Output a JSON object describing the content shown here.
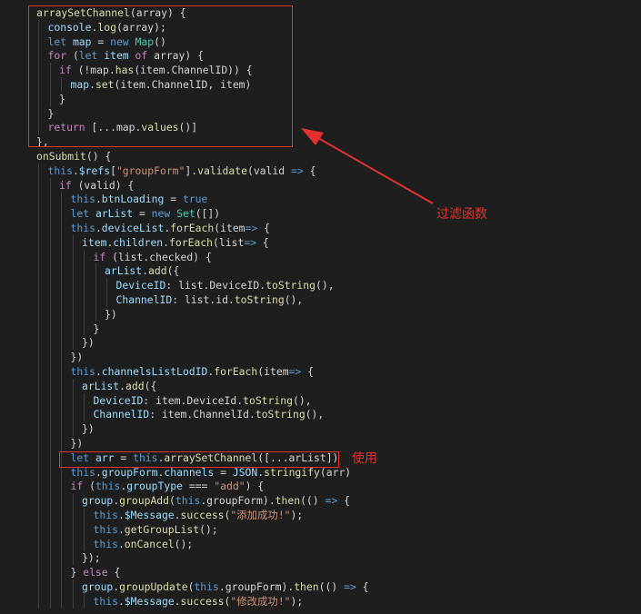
{
  "colors": {
    "background": "#1e1e1e",
    "keyword": "#569cd6",
    "control": "#c586c0",
    "function": "#dcdcaa",
    "variable": "#9cdcfe",
    "class": "#4ec9b0",
    "string": "#ce9178",
    "annotation": "#e0322f"
  },
  "annotations": {
    "filter_label": "过滤函数",
    "usage_label": "使用"
  },
  "code_lines": [
    {
      "indent": 1,
      "tokens": [
        [
          "fn",
          "arraySetChannel"
        ],
        [
          "punc",
          "(array) {"
        ]
      ]
    },
    {
      "indent": 2,
      "tokens": [
        [
          "var",
          "console"
        ],
        [
          "punc",
          "."
        ],
        [
          "fn",
          "log"
        ],
        [
          "punc",
          "(array);"
        ]
      ]
    },
    {
      "indent": 2,
      "tokens": [
        [
          "kw",
          "let "
        ],
        [
          "var",
          "map"
        ],
        [
          "punc",
          " = "
        ],
        [
          "kw",
          "new "
        ],
        [
          "cls",
          "Map"
        ],
        [
          "punc",
          "()"
        ]
      ]
    },
    {
      "indent": 2,
      "tokens": [
        [
          "ctl",
          "for "
        ],
        [
          "punc",
          "("
        ],
        [
          "kw",
          "let "
        ],
        [
          "var",
          "item "
        ],
        [
          "ctl",
          "of "
        ],
        [
          "punc",
          "array) {"
        ]
      ]
    },
    {
      "indent": 3,
      "tokens": [
        [
          "ctl",
          "if "
        ],
        [
          "punc",
          "(!map."
        ],
        [
          "fn",
          "has"
        ],
        [
          "punc",
          "(item.ChannelID)) {"
        ]
      ]
    },
    {
      "indent": 4,
      "tokens": [
        [
          "var",
          "map"
        ],
        [
          "punc",
          "."
        ],
        [
          "fn",
          "set"
        ],
        [
          "punc",
          "(item.ChannelID, item)"
        ]
      ]
    },
    {
      "indent": 3,
      "tokens": [
        [
          "punc",
          "}"
        ]
      ]
    },
    {
      "indent": 2,
      "tokens": [
        [
          "punc",
          "}"
        ]
      ]
    },
    {
      "indent": 2,
      "tokens": [
        [
          "ctl",
          "return "
        ],
        [
          "punc",
          "[...map."
        ],
        [
          "fn",
          "values"
        ],
        [
          "punc",
          "()]"
        ]
      ]
    },
    {
      "indent": 1,
      "tokens": [
        [
          "punc",
          "},"
        ]
      ]
    },
    {
      "indent": 1,
      "tokens": [
        [
          "fn",
          "onSubmit"
        ],
        [
          "punc",
          "() {"
        ]
      ]
    },
    {
      "indent": 2,
      "tokens": [
        [
          "kw",
          "this"
        ],
        [
          "punc",
          "."
        ],
        [
          "var",
          "$refs"
        ],
        [
          "punc",
          "["
        ],
        [
          "str",
          "\"groupForm\""
        ],
        [
          "punc",
          "]."
        ],
        [
          "fn",
          "validate"
        ],
        [
          "punc",
          "(valid "
        ],
        [
          "kw",
          "=>"
        ],
        [
          "punc",
          " {"
        ]
      ]
    },
    {
      "indent": 3,
      "tokens": [
        [
          "ctl",
          "if "
        ],
        [
          "punc",
          "(valid) {"
        ]
      ]
    },
    {
      "indent": 4,
      "tokens": [
        [
          "kw",
          "this"
        ],
        [
          "punc",
          "."
        ],
        [
          "var",
          "btnLoading"
        ],
        [
          "punc",
          " = "
        ],
        [
          "kw",
          "true"
        ]
      ]
    },
    {
      "indent": 4,
      "tokens": [
        [
          "kw",
          "let "
        ],
        [
          "var",
          "arList"
        ],
        [
          "punc",
          " = "
        ],
        [
          "kw",
          "new "
        ],
        [
          "cls",
          "Set"
        ],
        [
          "punc",
          "([])"
        ]
      ]
    },
    {
      "indent": 4,
      "tokens": [
        [
          "kw",
          "this"
        ],
        [
          "punc",
          "."
        ],
        [
          "var",
          "deviceList"
        ],
        [
          "punc",
          "."
        ],
        [
          "fn",
          "forEach"
        ],
        [
          "punc",
          "(item"
        ],
        [
          "kw",
          "=>"
        ],
        [
          "punc",
          " {"
        ]
      ]
    },
    {
      "indent": 5,
      "tokens": [
        [
          "var",
          "item"
        ],
        [
          "punc",
          "."
        ],
        [
          "var",
          "children"
        ],
        [
          "punc",
          "."
        ],
        [
          "fn",
          "forEach"
        ],
        [
          "punc",
          "(list"
        ],
        [
          "kw",
          "=>"
        ],
        [
          "punc",
          " {"
        ]
      ]
    },
    {
      "indent": 6,
      "tokens": [
        [
          "ctl",
          "if "
        ],
        [
          "punc",
          "(list.checked) {"
        ]
      ]
    },
    {
      "indent": 7,
      "tokens": [
        [
          "var",
          "arList"
        ],
        [
          "punc",
          "."
        ],
        [
          "fn",
          "add"
        ],
        [
          "punc",
          "({"
        ]
      ]
    },
    {
      "indent": 8,
      "tokens": [
        [
          "var",
          "DeviceID"
        ],
        [
          "punc",
          ": list.DeviceID."
        ],
        [
          "fn",
          "toString"
        ],
        [
          "punc",
          "(),"
        ]
      ]
    },
    {
      "indent": 8,
      "tokens": [
        [
          "var",
          "ChannelID"
        ],
        [
          "punc",
          ": list.id."
        ],
        [
          "fn",
          "toString"
        ],
        [
          "punc",
          "(),"
        ]
      ]
    },
    {
      "indent": 7,
      "tokens": [
        [
          "punc",
          "})"
        ]
      ]
    },
    {
      "indent": 6,
      "tokens": [
        [
          "punc",
          "}"
        ]
      ]
    },
    {
      "indent": 5,
      "tokens": [
        [
          "punc",
          "})"
        ]
      ]
    },
    {
      "indent": 4,
      "tokens": [
        [
          "punc",
          "})"
        ]
      ]
    },
    {
      "indent": 4,
      "tokens": [
        [
          "kw",
          "this"
        ],
        [
          "punc",
          "."
        ],
        [
          "var",
          "channelsListLodID"
        ],
        [
          "punc",
          "."
        ],
        [
          "fn",
          "forEach"
        ],
        [
          "punc",
          "(item"
        ],
        [
          "kw",
          "=>"
        ],
        [
          "punc",
          " {"
        ]
      ]
    },
    {
      "indent": 5,
      "tokens": [
        [
          "var",
          "arList"
        ],
        [
          "punc",
          "."
        ],
        [
          "fn",
          "add"
        ],
        [
          "punc",
          "({"
        ]
      ]
    },
    {
      "indent": 6,
      "tokens": [
        [
          "var",
          "DeviceID"
        ],
        [
          "punc",
          ": item.DeviceId."
        ],
        [
          "fn",
          "toString"
        ],
        [
          "punc",
          "(),"
        ]
      ]
    },
    {
      "indent": 6,
      "tokens": [
        [
          "var",
          "ChannelID"
        ],
        [
          "punc",
          ": item.ChannelId."
        ],
        [
          "fn",
          "toString"
        ],
        [
          "punc",
          "(),"
        ]
      ]
    },
    {
      "indent": 5,
      "tokens": [
        [
          "punc",
          "})"
        ]
      ]
    },
    {
      "indent": 4,
      "tokens": [
        [
          "punc",
          "})"
        ]
      ]
    },
    {
      "indent": 4,
      "tokens": [
        [
          "kw",
          "let "
        ],
        [
          "var",
          "arr"
        ],
        [
          "punc",
          " = "
        ],
        [
          "kw",
          "this"
        ],
        [
          "punc",
          "."
        ],
        [
          "fn",
          "arraySetChannel"
        ],
        [
          "punc",
          "([...arList])"
        ]
      ]
    },
    {
      "indent": 4,
      "tokens": [
        [
          "kw",
          "this"
        ],
        [
          "punc",
          "."
        ],
        [
          "var",
          "groupForm"
        ],
        [
          "punc",
          "."
        ],
        [
          "var",
          "channels"
        ],
        [
          "punc",
          " = "
        ],
        [
          "var",
          "JSON"
        ],
        [
          "punc",
          "."
        ],
        [
          "fn",
          "stringify"
        ],
        [
          "punc",
          "(arr)"
        ]
      ]
    },
    {
      "indent": 4,
      "tokens": [
        [
          "ctl",
          "if "
        ],
        [
          "punc",
          "("
        ],
        [
          "kw",
          "this"
        ],
        [
          "punc",
          "."
        ],
        [
          "var",
          "groupType"
        ],
        [
          "punc",
          " === "
        ],
        [
          "str",
          "\"add\""
        ],
        [
          "punc",
          ") {"
        ]
      ]
    },
    {
      "indent": 5,
      "tokens": [
        [
          "var",
          "group"
        ],
        [
          "punc",
          "."
        ],
        [
          "fn",
          "groupAdd"
        ],
        [
          "punc",
          "("
        ],
        [
          "kw",
          "this"
        ],
        [
          "punc",
          ".groupForm)."
        ],
        [
          "fn",
          "then"
        ],
        [
          "punc",
          "(() "
        ],
        [
          "kw",
          "=>"
        ],
        [
          "punc",
          " {"
        ]
      ]
    },
    {
      "indent": 6,
      "tokens": [
        [
          "kw",
          "this"
        ],
        [
          "punc",
          "."
        ],
        [
          "var",
          "$Message"
        ],
        [
          "punc",
          "."
        ],
        [
          "fn",
          "success"
        ],
        [
          "punc",
          "("
        ],
        [
          "str",
          "\"添加成功!\""
        ],
        [
          "punc",
          ");"
        ]
      ]
    },
    {
      "indent": 6,
      "tokens": [
        [
          "kw",
          "this"
        ],
        [
          "punc",
          "."
        ],
        [
          "fn",
          "getGroupList"
        ],
        [
          "punc",
          "();"
        ]
      ]
    },
    {
      "indent": 6,
      "tokens": [
        [
          "kw",
          "this"
        ],
        [
          "punc",
          "."
        ],
        [
          "fn",
          "onCancel"
        ],
        [
          "punc",
          "();"
        ]
      ]
    },
    {
      "indent": 5,
      "tokens": [
        [
          "punc",
          "});"
        ]
      ]
    },
    {
      "indent": 4,
      "tokens": [
        [
          "punc",
          "} "
        ],
        [
          "ctl",
          "else"
        ],
        [
          "punc",
          " {"
        ]
      ]
    },
    {
      "indent": 5,
      "tokens": [
        [
          "var",
          "group"
        ],
        [
          "punc",
          "."
        ],
        [
          "fn",
          "groupUpdate"
        ],
        [
          "punc",
          "("
        ],
        [
          "kw",
          "this"
        ],
        [
          "punc",
          ".groupForm)."
        ],
        [
          "fn",
          "then"
        ],
        [
          "punc",
          "(() "
        ],
        [
          "kw",
          "=>"
        ],
        [
          "punc",
          " {"
        ]
      ]
    },
    {
      "indent": 6,
      "tokens": [
        [
          "kw",
          "this"
        ],
        [
          "punc",
          "."
        ],
        [
          "var",
          "$Message"
        ],
        [
          "punc",
          "."
        ],
        [
          "fn",
          "success"
        ],
        [
          "punc",
          "("
        ],
        [
          "str",
          "\"修改成功!\""
        ],
        [
          "punc",
          ");"
        ]
      ]
    }
  ]
}
